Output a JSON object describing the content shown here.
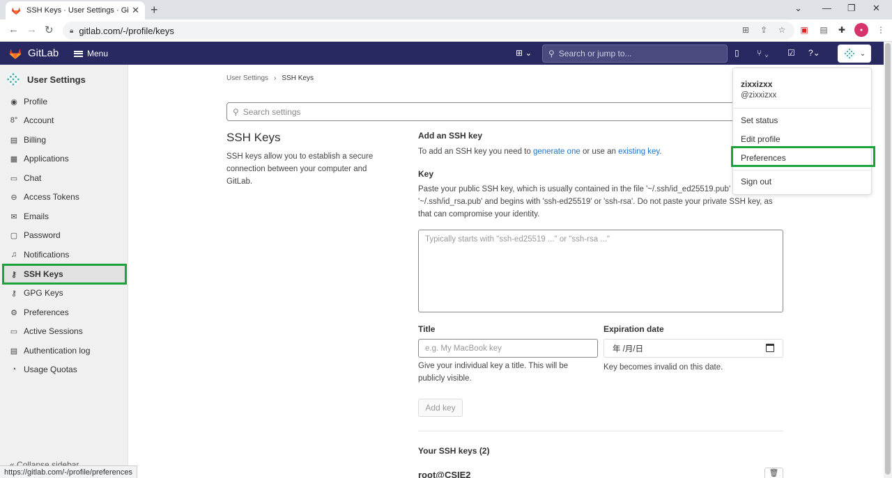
{
  "browser": {
    "tab_title": "SSH Keys · User Settings · GitLab",
    "url": "gitlab.com/-/profile/keys",
    "status_url": "https://gitlab.com/-/profile/preferences"
  },
  "header": {
    "brand": "GitLab",
    "menu_label": "Menu",
    "search_placeholder": "Search or jump to..."
  },
  "sidebar": {
    "title": "User Settings",
    "items": [
      {
        "label": "Profile",
        "icon": "user-circle-icon"
      },
      {
        "label": "Account",
        "icon": "account-icon"
      },
      {
        "label": "Billing",
        "icon": "billing-icon"
      },
      {
        "label": "Applications",
        "icon": "applications-icon"
      },
      {
        "label": "Chat",
        "icon": "chat-icon"
      },
      {
        "label": "Access Tokens",
        "icon": "token-icon"
      },
      {
        "label": "Emails",
        "icon": "mail-icon"
      },
      {
        "label": "Password",
        "icon": "lock-icon"
      },
      {
        "label": "Notifications",
        "icon": "bell-icon"
      },
      {
        "label": "SSH Keys",
        "icon": "key-icon"
      },
      {
        "label": "GPG Keys",
        "icon": "key-icon"
      },
      {
        "label": "Preferences",
        "icon": "preferences-icon"
      },
      {
        "label": "Active Sessions",
        "icon": "monitor-icon"
      },
      {
        "label": "Authentication log",
        "icon": "log-icon"
      },
      {
        "label": "Usage Quotas",
        "icon": "quota-icon"
      }
    ],
    "collapse_label": "Collapse sidebar"
  },
  "breadcrumb": {
    "parent": "User Settings",
    "current": "SSH Keys"
  },
  "content": {
    "search_placeholder": "Search settings",
    "section_title": "SSH Keys",
    "section_desc": "SSH keys allow you to establish a secure connection between your computer and GitLab.",
    "add_title": "Add an SSH key",
    "add_text_prefix": "To add an SSH key you need to ",
    "add_link_generate": "generate one",
    "add_text_middle": " or use an ",
    "add_link_existing": "existing key",
    "add_text_suffix": ".",
    "key_label": "Key",
    "key_help": "Paste your public SSH key, which is usually contained in the file '~/.ssh/id_ed25519.pub' or '~/.ssh/id_rsa.pub' and begins with 'ssh-ed25519' or 'ssh-rsa'. Do not paste your private SSH key, as that can compromise your identity.",
    "key_placeholder": "Typically starts with \"ssh-ed25519 ...\" or \"ssh-rsa ...\"",
    "title_label": "Title",
    "title_placeholder": "e.g. My MacBook key",
    "title_help": "Give your individual key a title. This will be publicly visible.",
    "expiration_label": "Expiration date",
    "expiration_value": "年 /月/日",
    "expiration_help": "Key becomes invalid on this date.",
    "add_button": "Add key",
    "your_keys_label": "Your SSH keys (2)",
    "first_key_title": "root@CSIE2"
  },
  "dropdown": {
    "name": "zixxizxx",
    "handle": "@zixxizxx",
    "items": [
      "Set status",
      "Edit profile",
      "Preferences",
      "Sign out"
    ]
  },
  "colors": {
    "header_bg": "#292961",
    "highlight": "#1aa33a",
    "link": "#1f75cb"
  }
}
